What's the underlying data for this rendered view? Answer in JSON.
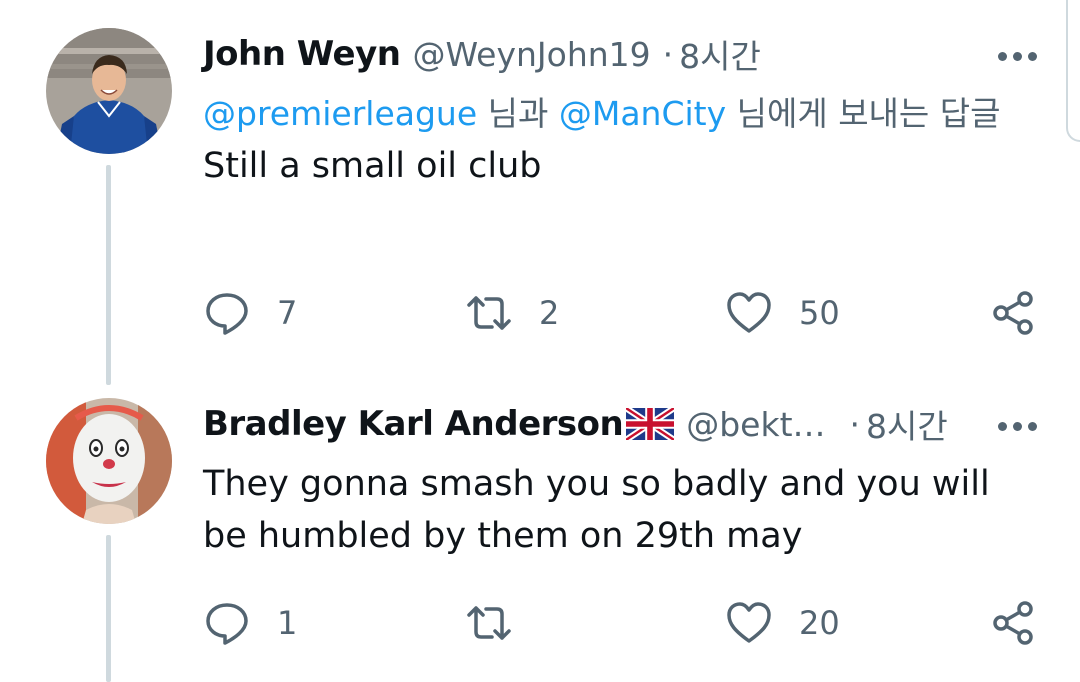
{
  "tweets": [
    {
      "display_name": "John Weyn",
      "handle": "@WeynJohn19",
      "time": "8시간",
      "reply_to": {
        "mention_1": "@premierleague",
        "connector": " 님과 ",
        "mention_2": "@ManCity",
        "suffix": " 님에게 보내는 답글"
      },
      "text": "Still a small oil club",
      "counts": {
        "replies": "7",
        "retweets": "2",
        "likes": "50"
      }
    },
    {
      "display_name": "Bradley Karl Anderson",
      "flag_icon": "united-kingdom-flag-icon",
      "handle": "@bekt…",
      "time": "8시간",
      "text": "They gonna smash you so badly and you will be humbled by them on 29th may",
      "counts": {
        "replies": "1",
        "retweets": "",
        "likes": "20"
      }
    }
  ],
  "icons": [
    "reply-icon",
    "retweet-icon",
    "like-icon",
    "share-icon",
    "more-options-icon"
  ],
  "colors": {
    "text": "#0f1419",
    "secondary": "#536471",
    "link": "#1d9bf0",
    "thread_line": "#cfd9de"
  }
}
